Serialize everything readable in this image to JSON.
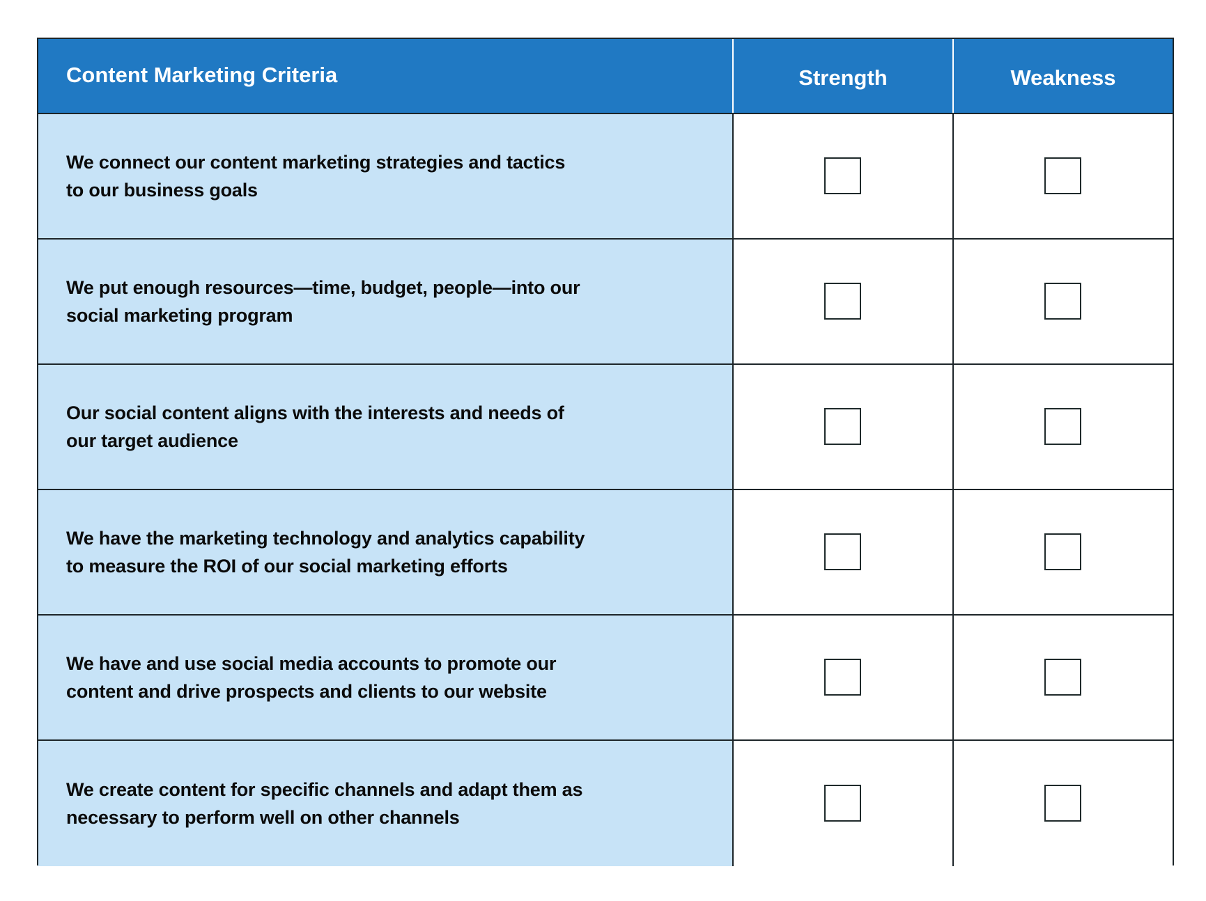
{
  "table": {
    "headers": {
      "criteria": "Content Marketing Criteria",
      "strength": "Strength",
      "weakness": "Weakness"
    },
    "rows": [
      {
        "line1": "We connect our content marketing strategies and tactics",
        "line2": "to our business goals",
        "strength_checked": false,
        "weakness_checked": false
      },
      {
        "line1": "We put enough resources—time, budget, people—into our",
        "line2": "social marketing program",
        "strength_checked": false,
        "weakness_checked": false
      },
      {
        "line1": "Our social content aligns with the interests and needs of",
        "line2": "our target audience",
        "strength_checked": false,
        "weakness_checked": false
      },
      {
        "line1": "We have the marketing technology and analytics capability",
        "line2": "to measure the ROI of our social marketing efforts",
        "strength_checked": false,
        "weakness_checked": false
      },
      {
        "line1": "We have and use social media accounts to promote our",
        "line2": "content and drive prospects and clients to our website",
        "strength_checked": false,
        "weakness_checked": false
      },
      {
        "line1": "We create content for specific channels and adapt them as",
        "line2": "necessary to perform well on other channels",
        "strength_checked": false,
        "weakness_checked": false
      }
    ]
  },
  "colors": {
    "header_background": "#2079C3",
    "criteria_cell_background": "#C7E3F7",
    "border": "#1d2529",
    "header_text": "#ffffff",
    "body_text": "#0b0b0b"
  }
}
